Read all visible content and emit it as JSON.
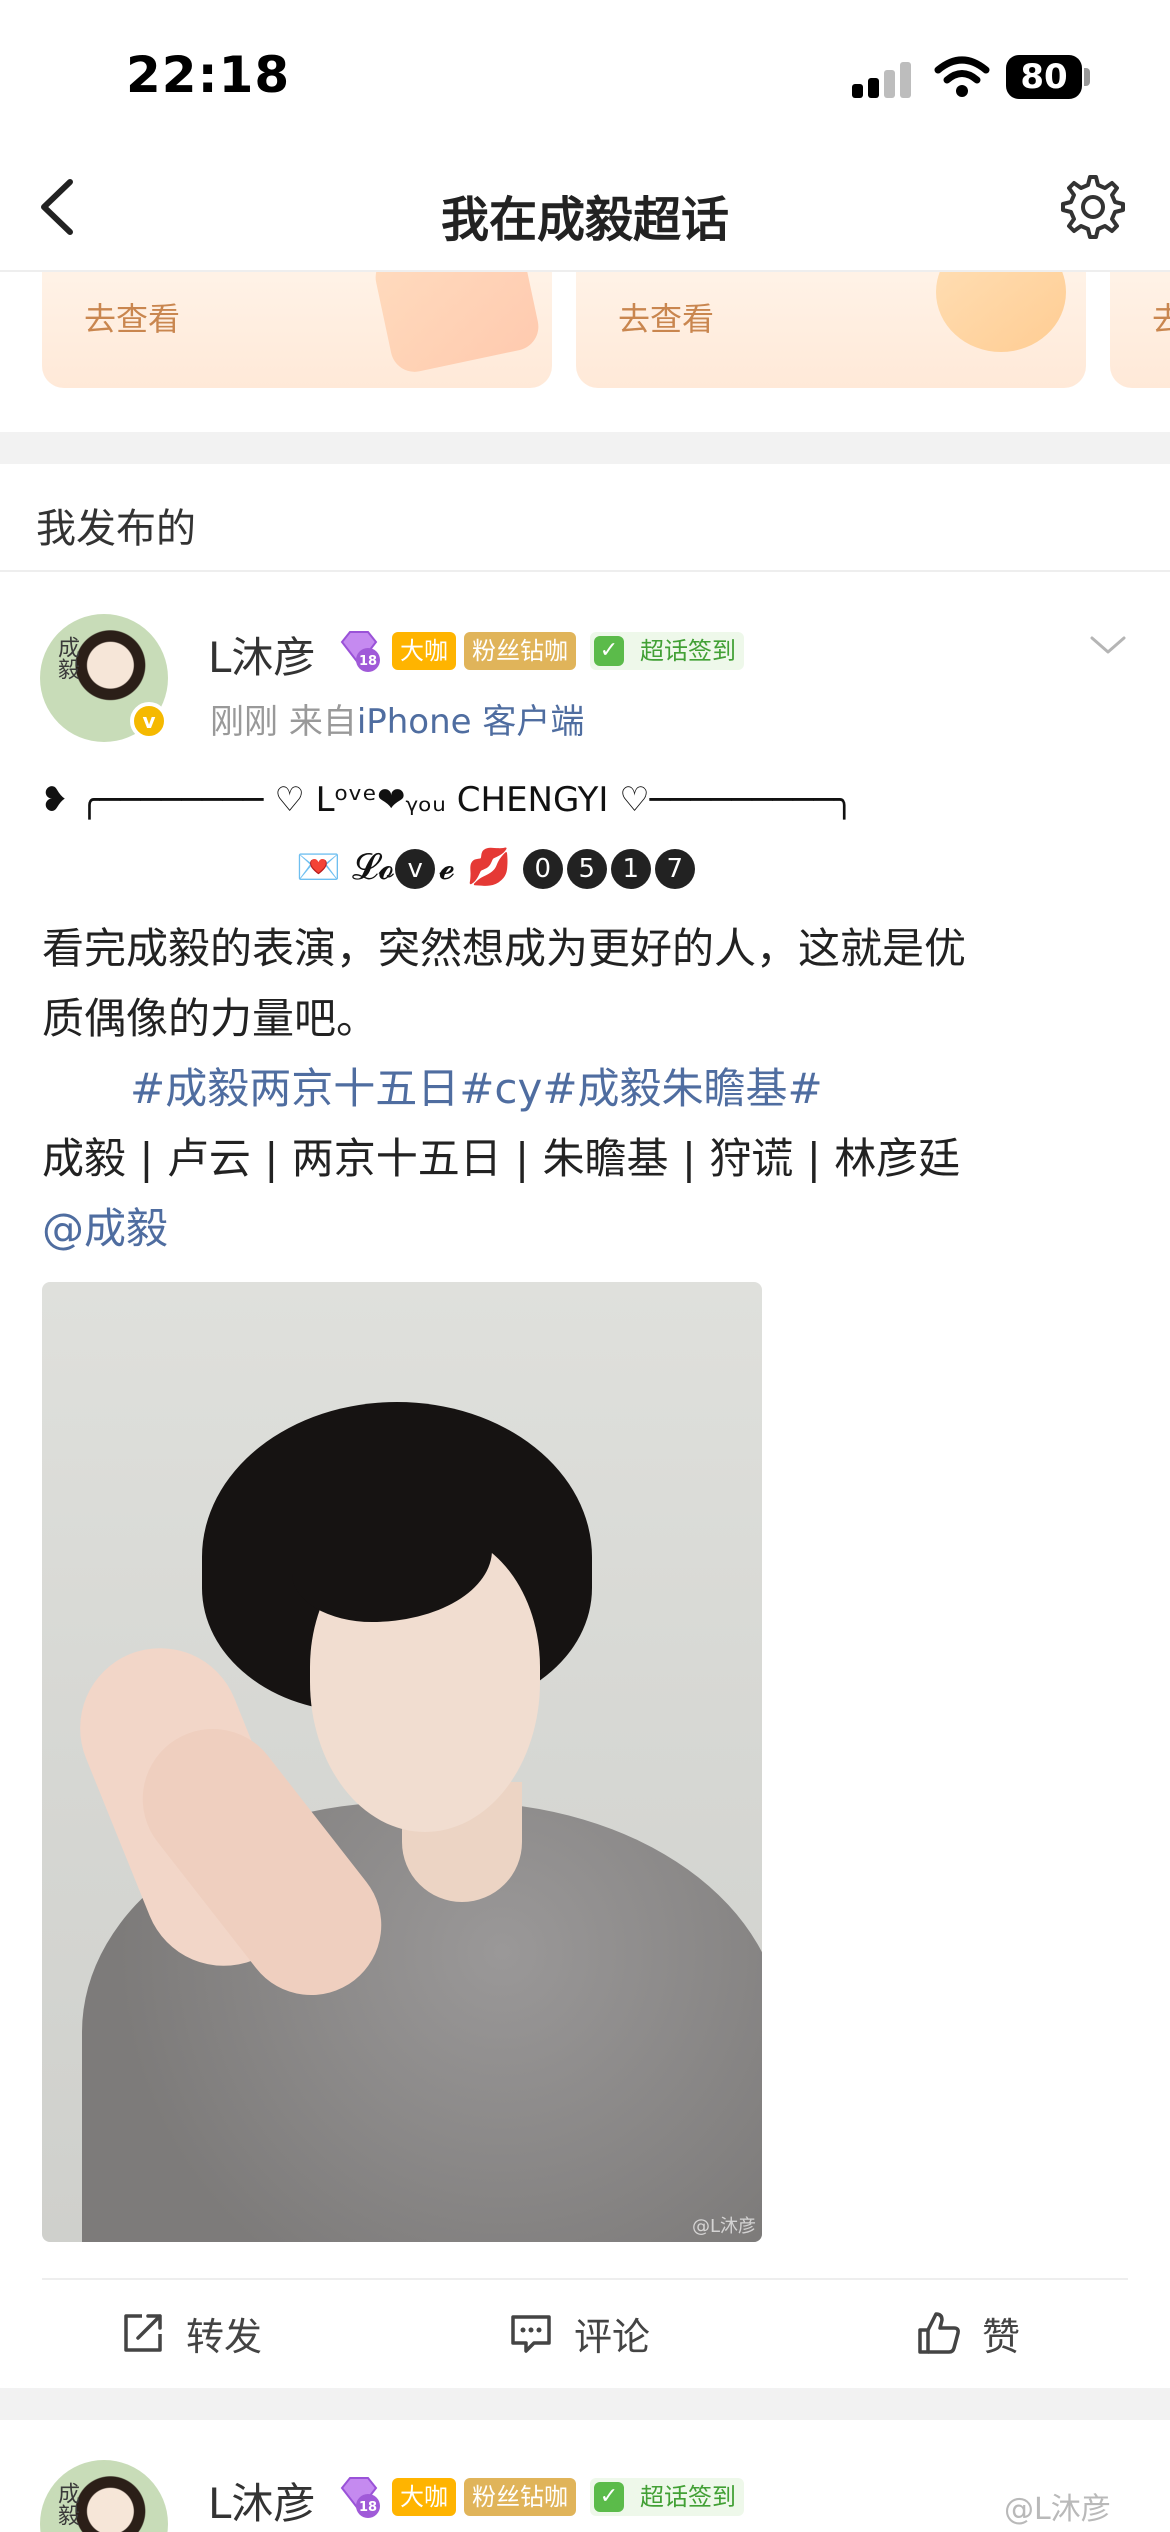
{
  "status_bar": {
    "time": "22:18",
    "battery": "80"
  },
  "nav": {
    "title": "我在成毅超话"
  },
  "cards": [
    {
      "link": "去查看"
    },
    {
      "link": "去查看"
    },
    {
      "link": "去"
    }
  ],
  "section": {
    "title": "我发布的"
  },
  "post": {
    "avatar_text": "成毅",
    "user": "L沐彦",
    "level": "18",
    "badges": {
      "big": "大咖",
      "fan": "粉丝钻咖",
      "sign": "超话签到"
    },
    "time": "刚刚",
    "from_label": "来自",
    "source": "iPhone 客户端",
    "deco_line1": "❥ ╭──────── ♡ Lᵒᵛᵉ❤ᵧₒᵤ CHENGYI ♡─────────╮",
    "deco_line2_prefix": "💌 𝓛𝓸",
    "deco_v": "v",
    "deco_e": "𝓮 💋",
    "deco_nums": [
      "0",
      "5",
      "1",
      "7"
    ],
    "text_line1": "看完成毅的表演，突然想成为更好的人，这就是优",
    "text_line2": "质偶像的力量吧。",
    "tags": "#成毅两京十五日#cy#成毅朱瞻基#",
    "roles": "成毅 | 卢云 | 两京十五日 | 朱瞻基  | 狩谎 | 林彦廷",
    "mention": "@成毅",
    "image_watermark": "@L沐彦",
    "actions": {
      "repost": "转发",
      "comment": "评论",
      "like": "赞"
    }
  },
  "next_post": {
    "avatar_text": "成毅",
    "user": "L沐彦",
    "level": "18",
    "badges": {
      "big": "大咖",
      "fan": "粉丝钻咖",
      "sign": "超话签到"
    }
  },
  "watermark": "@L沐彦"
}
